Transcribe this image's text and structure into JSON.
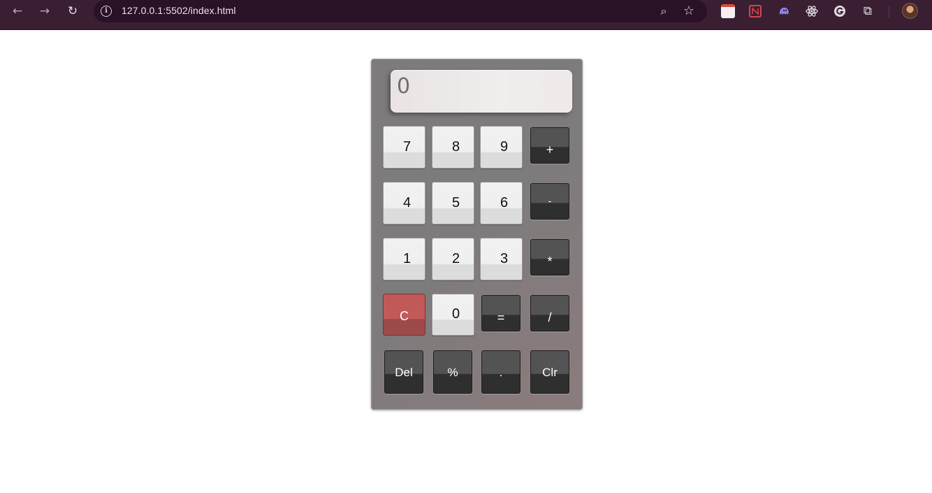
{
  "browser": {
    "url": "127.0.0.1:5502/index.html",
    "icons": {
      "back": "←",
      "forward": "→",
      "reload": "↻",
      "info": "i",
      "zoom": "⌕",
      "bookmark": "☆",
      "extensions": "⧉"
    }
  },
  "calculator": {
    "display_value": "0",
    "rows": [
      [
        {
          "label": "7",
          "kind": "number"
        },
        {
          "label": "8",
          "kind": "number"
        },
        {
          "label": "9",
          "kind": "number"
        },
        {
          "label": "+",
          "kind": "operator"
        }
      ],
      [
        {
          "label": "4",
          "kind": "number"
        },
        {
          "label": "5",
          "kind": "number"
        },
        {
          "label": "6",
          "kind": "number"
        },
        {
          "label": "-",
          "kind": "operator"
        }
      ],
      [
        {
          "label": "1",
          "kind": "number"
        },
        {
          "label": "2",
          "kind": "number"
        },
        {
          "label": "3",
          "kind": "number"
        },
        {
          "label": "*",
          "kind": "operator"
        }
      ],
      [
        {
          "label": "C",
          "kind": "clear"
        },
        {
          "label": "0",
          "kind": "number"
        },
        {
          "label": "=",
          "kind": "operator"
        },
        {
          "label": "/",
          "kind": "operator"
        }
      ],
      [
        {
          "label": "Del",
          "kind": "function"
        },
        {
          "label": "%",
          "kind": "function"
        },
        {
          "label": ".",
          "kind": "function"
        },
        {
          "label": "Clr",
          "kind": "function"
        }
      ]
    ]
  },
  "colors": {
    "toolbar": "#3a1f33",
    "clear_key": "#c15a5a",
    "operator_key": "#545353",
    "number_key": "#f1f1f1"
  }
}
